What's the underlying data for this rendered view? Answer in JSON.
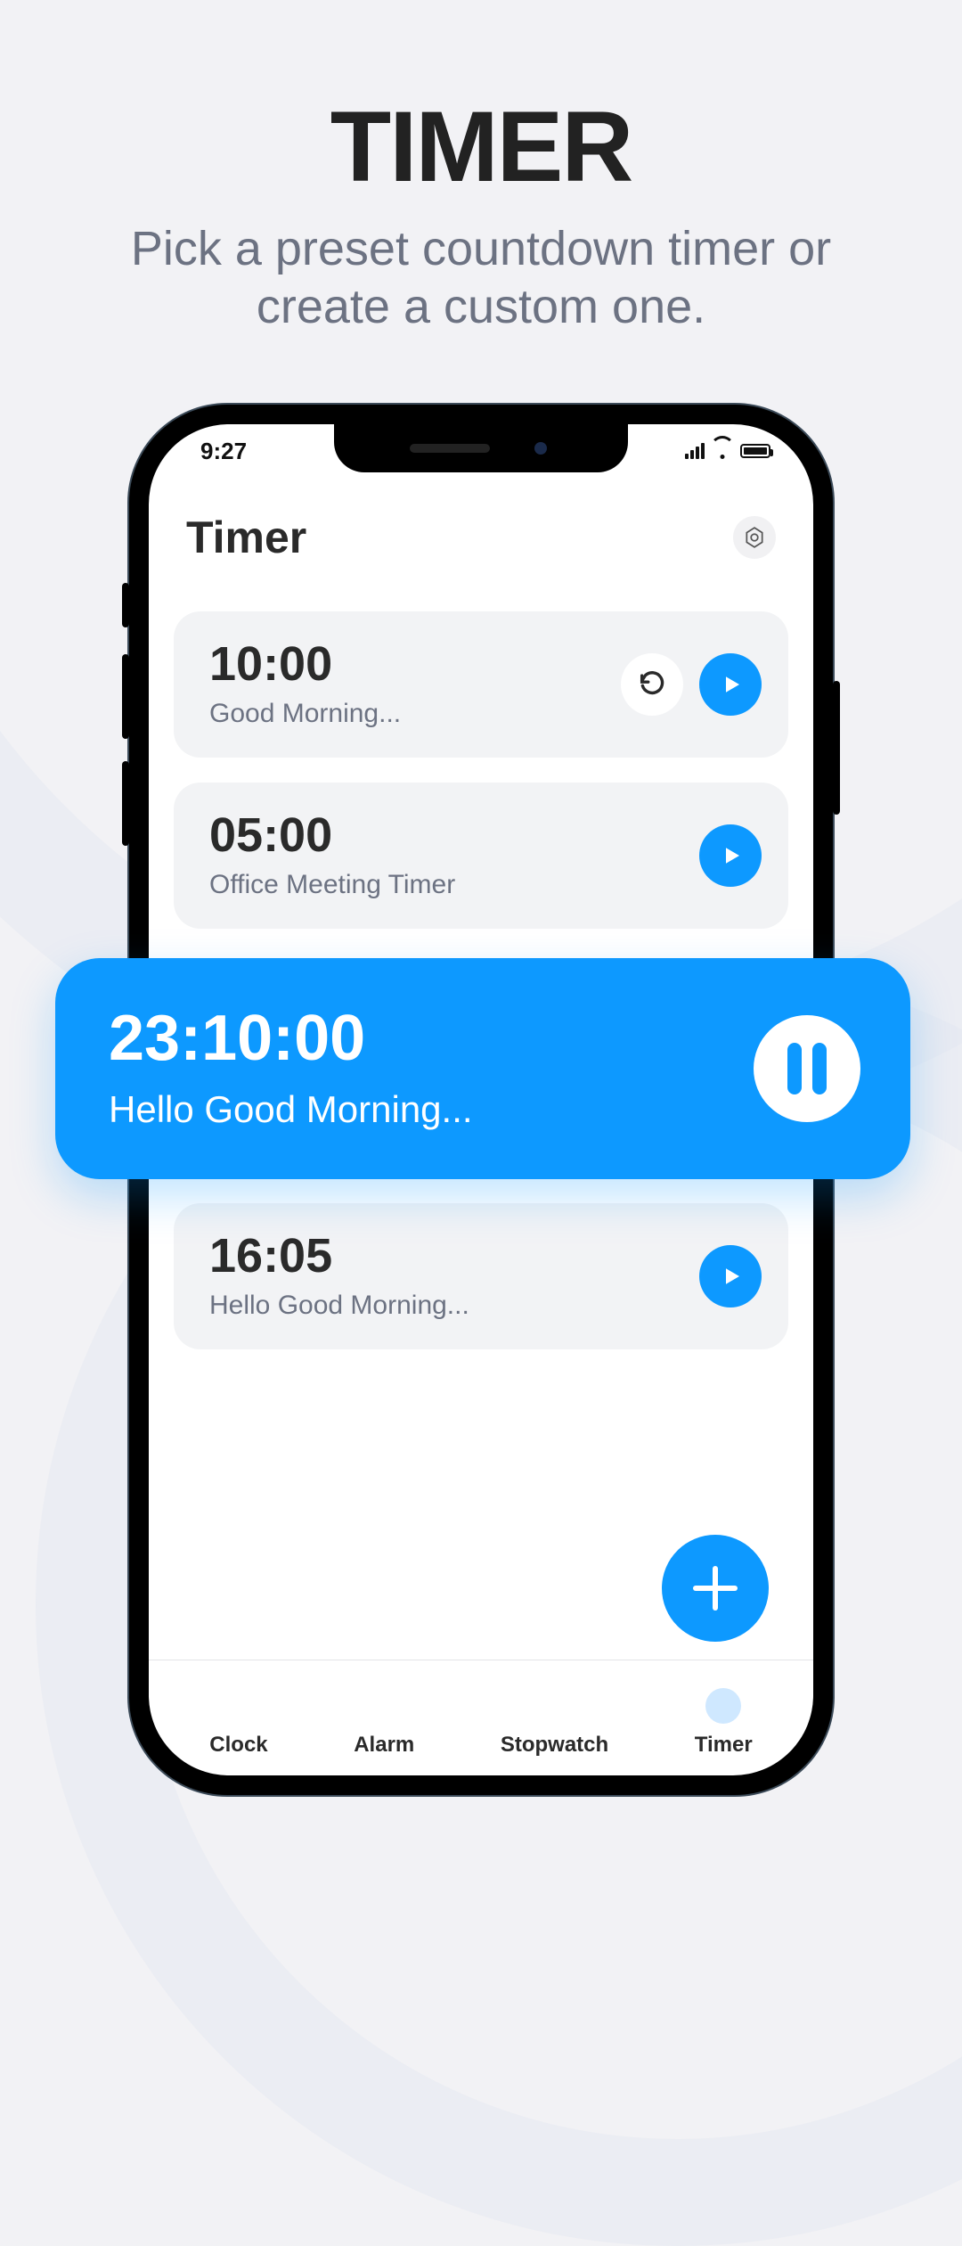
{
  "promo": {
    "title": "TIMER",
    "subtitle": "Pick a preset countdown timer or create a custom one."
  },
  "status": {
    "time": "9:27"
  },
  "header": {
    "title": "Timer"
  },
  "timers": [
    {
      "time": "10:00",
      "label": "Good Morning...",
      "show_reset": true
    },
    {
      "time": "05:00",
      "label": "Office Meeting Timer",
      "show_reset": false
    },
    {
      "time": "16:05",
      "label": "Hello Good Morning...",
      "show_reset": false
    }
  ],
  "active_timer": {
    "time": "23:10:00",
    "label": "Hello Good Morning..."
  },
  "tabs": [
    {
      "label": "Clock"
    },
    {
      "label": "Alarm"
    },
    {
      "label": "Stopwatch"
    },
    {
      "label": "Timer"
    }
  ],
  "colors": {
    "accent": "#0d99ff"
  }
}
